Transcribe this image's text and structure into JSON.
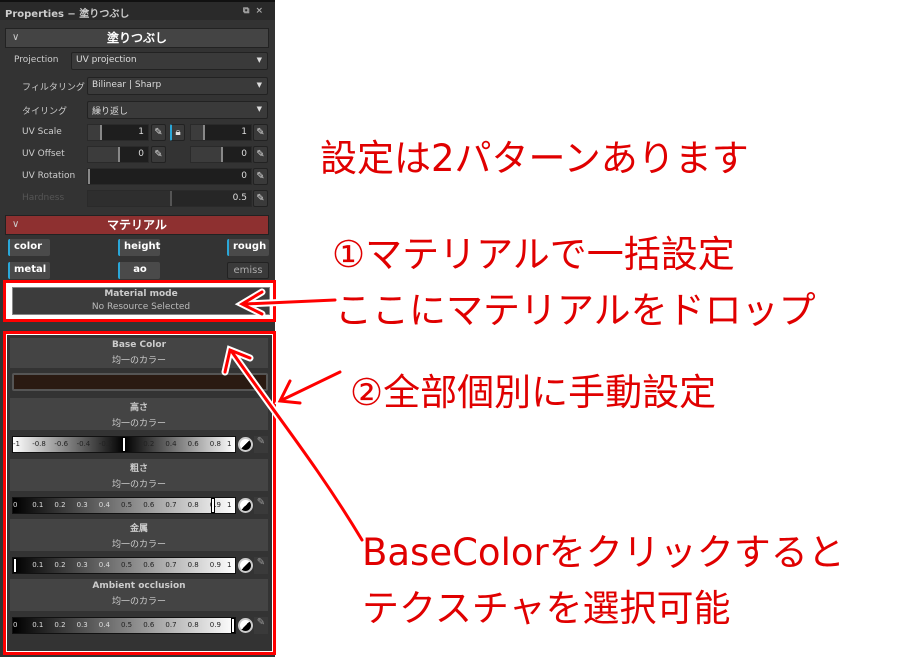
{
  "panel": {
    "title": "Properties − 塗りつぶし",
    "section_fill": "塗りつぶし",
    "section_material": "マテリアル",
    "projection": {
      "label": "Projection",
      "value": "UV projection"
    },
    "filtering": {
      "label": "フィルタリング",
      "value": "Bilinear | Sharp"
    },
    "tiling": {
      "label": "タイリング",
      "value": "繰り返し"
    },
    "uv_scale": {
      "label": "UV Scale",
      "u": "1",
      "v": "1"
    },
    "uv_offset": {
      "label": "UV Offset",
      "u": "0",
      "v": "0"
    },
    "uv_rotation": {
      "label": "UV Rotation",
      "value": "0"
    },
    "hardness": {
      "label": "Hardness",
      "value": "0.5"
    },
    "channels": [
      "color",
      "height",
      "rough",
      "metal",
      "ao",
      "emiss"
    ],
    "material_mode": {
      "title": "Material mode",
      "value": "No Resource Selected"
    },
    "base_color": {
      "title": "Base Color",
      "mode": "均一のカラー",
      "color": "#2a1a12"
    },
    "height": {
      "title": "高さ",
      "mode": "均一のカラー",
      "ticks": [
        "-1",
        "-0.8",
        "-0.6",
        "-0.4",
        "-0.2",
        "0.2",
        "0.4",
        "0.6",
        "0.8",
        "1"
      ],
      "value": 0
    },
    "roughness": {
      "title": "粗さ",
      "mode": "均一のカラー",
      "ticks": [
        "0",
        "0.1",
        "0.2",
        "0.3",
        "0.4",
        "0.5",
        "0.6",
        "0.7",
        "0.8",
        "0.9",
        "1"
      ],
      "value": 0.9
    },
    "metal": {
      "title": "金属",
      "mode": "均一のカラー",
      "ticks": [
        "0.1",
        "0.2",
        "0.3",
        "0.4",
        "0.5",
        "0.6",
        "0.7",
        "0.8",
        "0.9",
        "1"
      ],
      "value": 0
    },
    "ao": {
      "title": "Ambient occlusion",
      "mode": "均一のカラー",
      "ticks": [
        "0",
        "0.1",
        "0.2",
        "0.3",
        "0.4",
        "0.5",
        "0.6",
        "0.7",
        "0.8",
        "0.9"
      ],
      "value": 1
    }
  },
  "annotations": {
    "headline": "設定は2パターンあります",
    "p1": "①マテリアルで一括設定",
    "p1b": "ここにマテリアルをドロップ",
    "p2": "②全部個別に手動設定",
    "p3a": "BaseColorをクリックすると",
    "p3b": "テクスチャを選択可能",
    "color": "#e00000"
  }
}
